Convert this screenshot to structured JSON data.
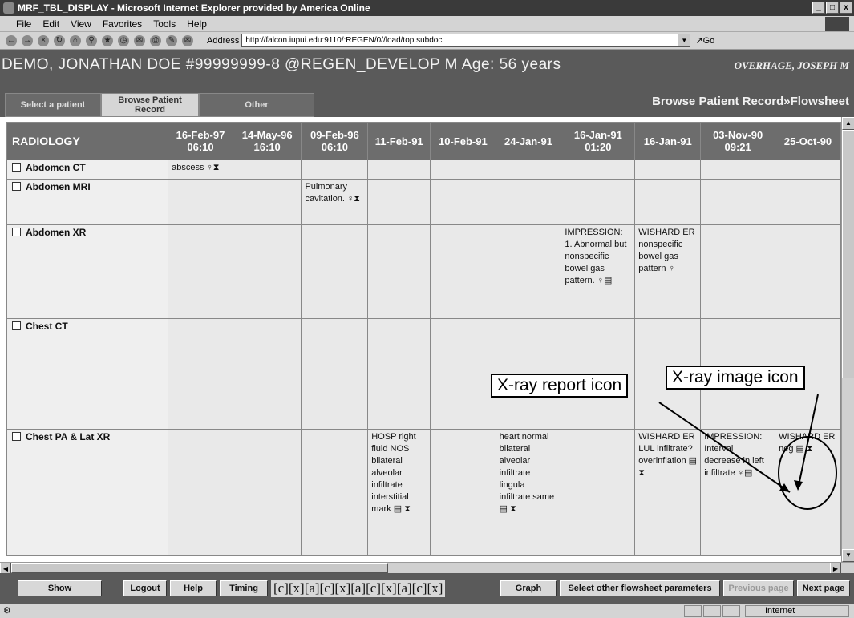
{
  "window": {
    "title": "MRF_TBL_DISPLAY - Microsoft Internet Explorer provided by America Online",
    "controls": [
      "_",
      "□",
      "x"
    ]
  },
  "menu": [
    "File",
    "Edit",
    "View",
    "Favorites",
    "Tools",
    "Help"
  ],
  "toolbar": {
    "address_label": "Address",
    "url": "http://falcon.iupui.edu:9110/:REGEN/0//load/top.subdoc",
    "go_label": "Go"
  },
  "header": {
    "patient": "DEMO, JONATHAN DOE  #99999999-8 @REGEN_DEVELOP  M  Age: 56 years",
    "physician": "OVERHAGE, JOSEPH M"
  },
  "nav": {
    "tabs": [
      "Select a patient",
      "Browse Patient Record",
      "Other"
    ],
    "breadcrumb": "Browse Patient Record»Flowsheet"
  },
  "table": {
    "corner": "RADIOLOGY",
    "columns": [
      [
        "16-Feb-97",
        "06:10"
      ],
      [
        "14-May-96",
        "16:10"
      ],
      [
        "09-Feb-96",
        "06:10"
      ],
      [
        "11-Feb-91",
        ""
      ],
      [
        "10-Feb-91",
        ""
      ],
      [
        "24-Jan-91",
        ""
      ],
      [
        "16-Jan-91",
        "01:20"
      ],
      [
        "16-Jan-91",
        ""
      ],
      [
        "03-Nov-90",
        "09:21"
      ],
      [
        "25-Oct-90",
        ""
      ]
    ],
    "rows": [
      {
        "label": "Abdomen CT",
        "cells": [
          "abscess ♀⧗",
          "",
          "",
          "",
          "",
          "",
          "",
          "",
          "",
          ""
        ]
      },
      {
        "label": "Abdomen MRI",
        "cells": [
          "",
          "",
          "Pulmonary cavitation. ♀⧗",
          "",
          "",
          "",
          "",
          "",
          "",
          ""
        ]
      },
      {
        "label": "Abdomen XR",
        "cells": [
          "",
          "",
          "",
          "",
          "",
          "",
          "IMPRESSION: 1. Abnormal but nonspecific bowel gas pattern. ♀▤",
          "WISHARD ER nonspecific bowel gas pattern ♀",
          "",
          ""
        ]
      },
      {
        "label": "Chest CT",
        "cells": [
          "",
          "",
          "",
          "",
          "",
          "",
          "",
          "",
          "",
          ""
        ]
      },
      {
        "label": "Chest PA & Lat XR",
        "cells": [
          "",
          "",
          "",
          "HOSP right fluid NOS bilateral alveolar infiltrate interstitial mark ▤ ⧗",
          "",
          "heart normal bilateral alveolar infiltrate lingula infiltrate same ▤ ⧗",
          "",
          "WISHARD ER LUL infiltrate? overinflation ▤ ⧗",
          "IMPRESSION: Interval decrease in left infiltrate ♀▤",
          "WISHARD ER neg ▤ ⧗"
        ]
      }
    ]
  },
  "annotations": {
    "report_icon": "X-ray report icon",
    "image_icon": "X-ray image icon"
  },
  "buttons": {
    "show": "Show",
    "logout": "Logout",
    "help": "Help",
    "timing": "Timing",
    "links": "[c][x][a][c][x][a][c][x][a][c][x]",
    "graph": "Graph",
    "select_other": "Select other flowsheet parameters",
    "previous": "Previous page",
    "next": "Next page"
  },
  "status": {
    "zone": "Internet"
  }
}
